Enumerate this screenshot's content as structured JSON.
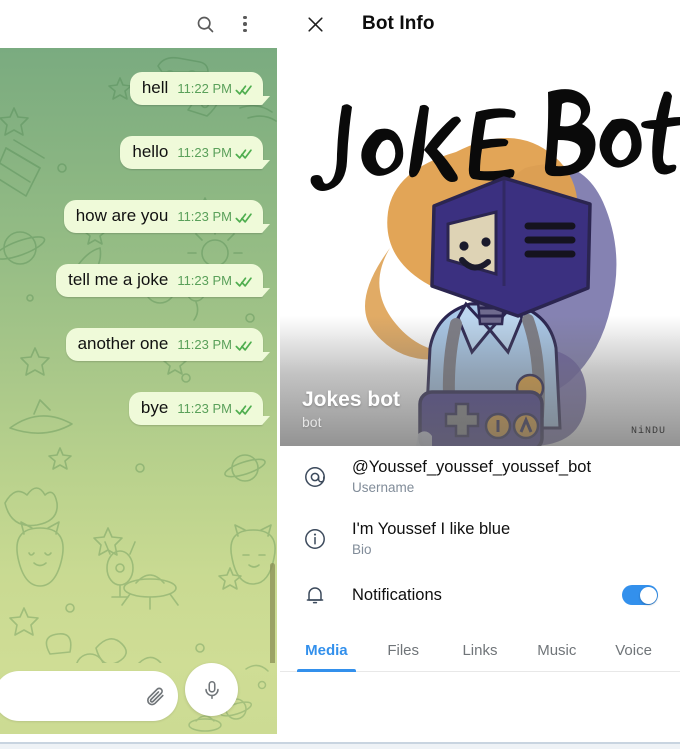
{
  "chat": {
    "header": {
      "search_icon": "search-icon",
      "menu_icon": "overflow-menu-icon"
    },
    "messages": [
      {
        "text": "hell",
        "time": "11:22 PM",
        "status": "read",
        "outgoing": true
      },
      {
        "text": "hello",
        "time": "11:23 PM",
        "status": "read",
        "outgoing": true
      },
      {
        "text": "how are you",
        "time": "11:23 PM",
        "status": "read",
        "outgoing": true
      },
      {
        "text": "tell me a joke",
        "time": "11:23 PM",
        "status": "read",
        "outgoing": true
      },
      {
        "text": "another one",
        "time": "11:23 PM",
        "status": "read",
        "outgoing": true
      },
      {
        "text": "bye",
        "time": "11:23 PM",
        "status": "read",
        "outgoing": true
      }
    ],
    "composer": {
      "input_value": "",
      "input_placeholder": "",
      "attach_icon": "paperclip-icon",
      "mic_icon": "microphone-icon"
    },
    "theme": {
      "bubble_color": "#effad9",
      "time_color": "#5aa05a",
      "tick_color": "#4fae4f",
      "background_top": "#7aab80",
      "background_bottom": "#cfdd95"
    }
  },
  "info": {
    "close_icon": "close-icon",
    "title": "Bot Info",
    "cover": {
      "artwork_title": "JOKE BOT",
      "watermark": "NiNDU",
      "name": "Jokes bot",
      "subtitle": "bot"
    },
    "rows": [
      {
        "icon": "at-sign-icon",
        "primary": "@Youssef_youssef_youssef_bot",
        "secondary": "Username"
      },
      {
        "icon": "info-circle-icon",
        "primary": "I'm Youssef I like blue",
        "secondary": "Bio"
      }
    ],
    "notifications": {
      "icon": "bell-icon",
      "label": "Notifications",
      "enabled": true,
      "toggle_color": "#3390ec"
    },
    "tabs": [
      {
        "label": "Media",
        "active": true
      },
      {
        "label": "Files",
        "active": false
      },
      {
        "label": "Links",
        "active": false
      },
      {
        "label": "Music",
        "active": false
      },
      {
        "label": "Voice",
        "active": false
      }
    ],
    "accent_color": "#3390ec"
  }
}
